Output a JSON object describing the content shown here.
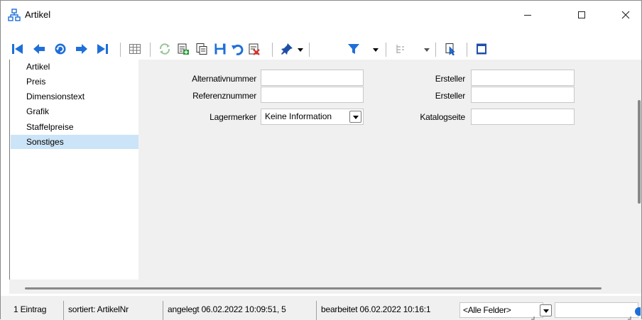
{
  "window": {
    "title": "Artikel"
  },
  "toolbar": {
    "icons": [
      "first-record-icon",
      "prev-record-icon",
      "history-icon",
      "next-record-icon",
      "last-record-icon",
      "table-view-icon",
      "refresh-icon",
      "new-record-icon",
      "copy-record-icon",
      "save-icon",
      "undo-icon",
      "delete-icon",
      "pin-icon",
      "filter-icon",
      "tree-icon",
      "select-icon",
      "window-icon"
    ]
  },
  "tree": {
    "items": [
      {
        "label": "Artikel"
      },
      {
        "label": "Preis"
      },
      {
        "label": "Dimensionstext"
      },
      {
        "label": "Grafik"
      },
      {
        "label": "Staffelpreise"
      },
      {
        "label": "Sonstiges",
        "selected": true
      }
    ]
  },
  "form": {
    "alternativnummer_label": "Alternativnummer",
    "referenznummer_label": "Referenznummer",
    "lagermerker_label": "Lagermerker",
    "lagermerker_value": "Keine Information",
    "ersteller1_label": "Ersteller",
    "ersteller2_label": "Ersteller",
    "katalogseite_label": "Katalogseite"
  },
  "status": {
    "count": "1 Eintrag",
    "sorted": "sortiert: ArtikelNr",
    "created": "angelegt 06.02.2022 10:09:51, 5",
    "edited": "bearbeitet 06.02.2022 10:16:1",
    "field_filter": "<Alle Felder>"
  },
  "colors": {
    "selection": "#cce4f7",
    "nav_blue": "#1e6fd9",
    "content_bg": "#f0f0f0"
  }
}
